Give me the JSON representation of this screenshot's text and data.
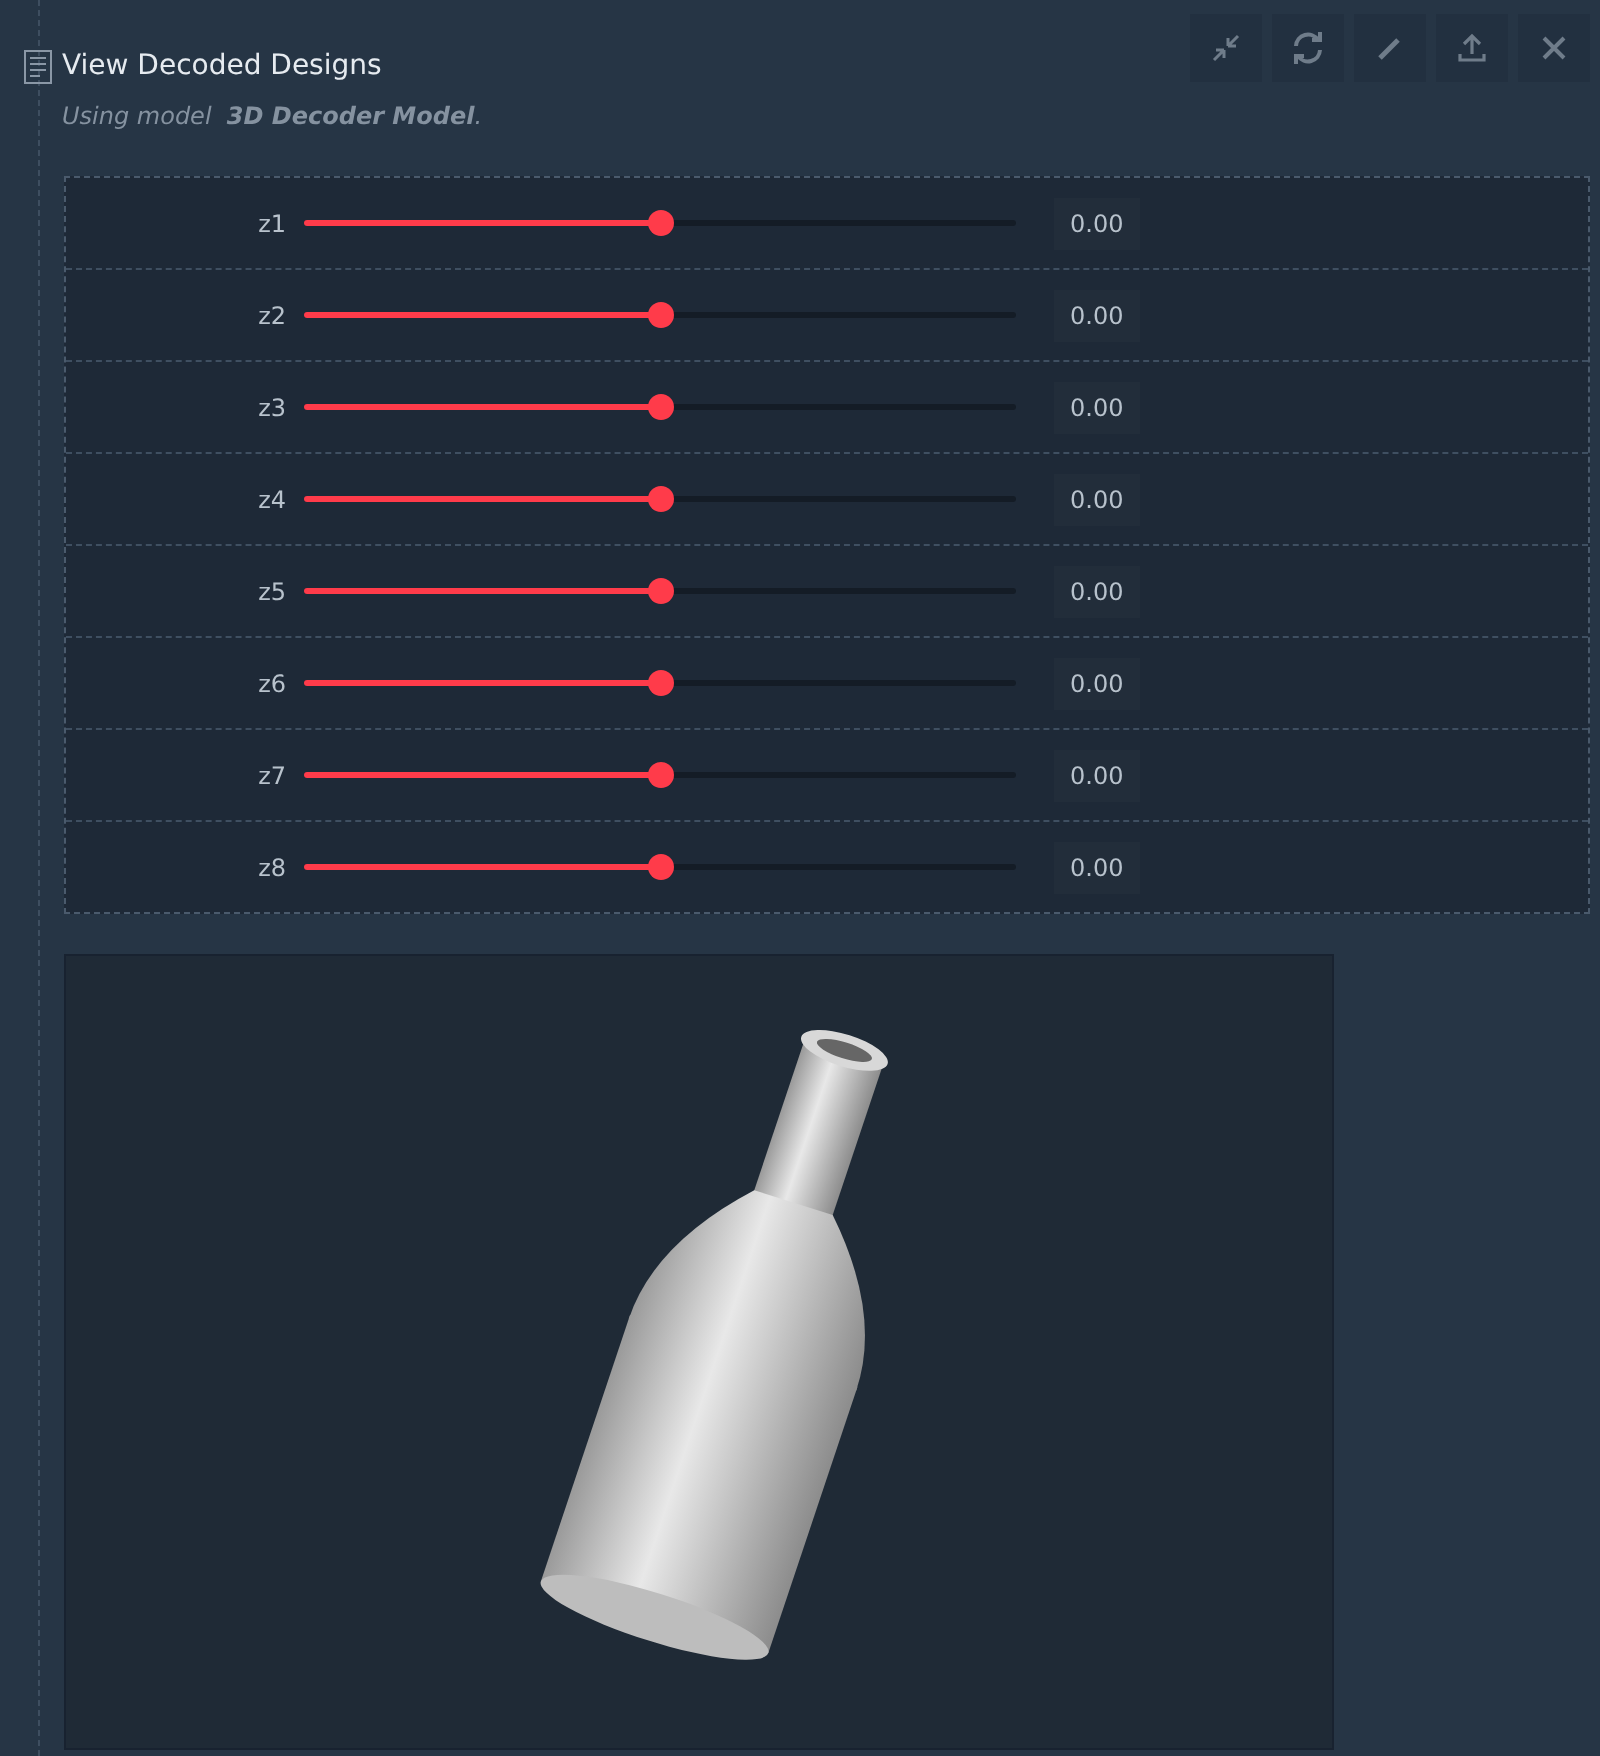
{
  "header": {
    "title": "View Decoded Designs",
    "subtitle": "Using model  **3D Decoder Model**.",
    "toolbar": [
      {
        "kind": "collapse"
      },
      {
        "kind": "refresh"
      },
      {
        "kind": "edit"
      },
      {
        "kind": "upload"
      },
      {
        "kind": "close"
      }
    ]
  },
  "sliders": [
    {
      "label": "z1",
      "level": 0.5,
      "value": "0.00"
    },
    {
      "label": "z2",
      "level": 0.5,
      "value": "0.00"
    },
    {
      "label": "z3",
      "level": 0.5,
      "value": "0.00"
    },
    {
      "label": "z4",
      "level": 0.5,
      "value": "0.00"
    },
    {
      "label": "z5",
      "level": 0.5,
      "value": "0.00"
    },
    {
      "label": "z6",
      "level": 0.5,
      "value": "0.00"
    },
    {
      "label": "z7",
      "level": 0.5,
      "value": "0.00"
    },
    {
      "label": "z8",
      "level": 0.5,
      "value": "0.00"
    }
  ]
}
